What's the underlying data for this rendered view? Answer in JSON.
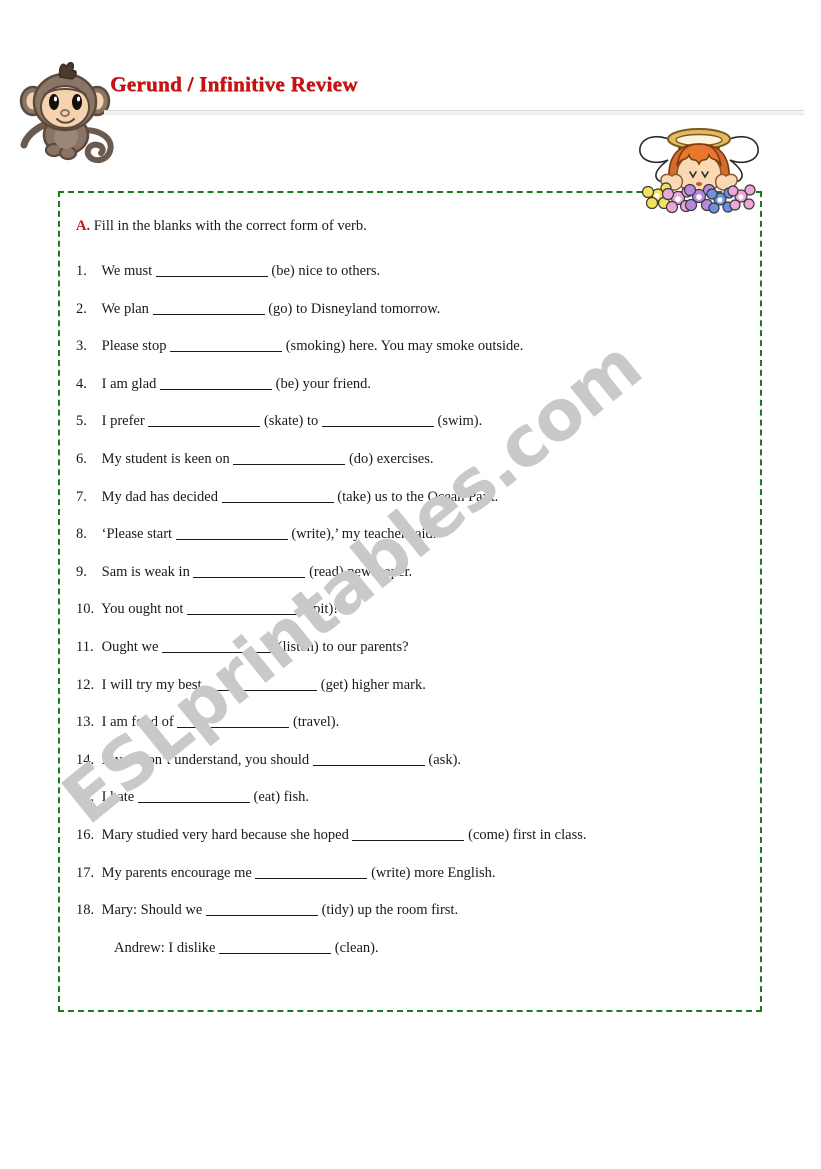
{
  "header": {
    "title": "Gerund / Infinitive Review",
    "title_color": "#cc1111",
    "monkey_icon": "monkey-clipart",
    "angel_icon": "angel-with-flowers-clipart"
  },
  "watermark": {
    "text": "ESLprintables.com",
    "color": "#c9c9c9"
  },
  "worksheet": {
    "border_color": "#1e7a1e",
    "instruction_marker": "A.",
    "instruction_text": "Fill in the blanks with the correct form of verb.",
    "items": [
      {
        "num": "1.",
        "pre": "We must",
        "cue": "(be) nice to others.",
        "blank_width": 112
      },
      {
        "num": "2.",
        "pre": "We plan",
        "cue": "(go) to Disneyland tomorrow.",
        "blank_width": 112
      },
      {
        "num": "3.",
        "pre": "Please stop",
        "cue": "(smoking) here.  You may smoke outside.",
        "blank_width": 112
      },
      {
        "num": "4.",
        "pre": "I am glad",
        "cue": "(be) your friend.",
        "blank_width": 112
      },
      {
        "num": "5.",
        "pre": "I prefer",
        "cue": "(skate) to",
        "blank_width": 112,
        "cue2": "(swim).",
        "blank2_width": 112
      },
      {
        "num": "6.",
        "pre": "My student is keen on",
        "cue": "(do) exercises.",
        "blank_width": 112
      },
      {
        "num": "7.",
        "pre": "My dad has decided",
        "cue": "(take) us to the Ocean Park.",
        "blank_width": 112
      },
      {
        "num": "8.",
        "pre": "‘Please start",
        "cue": "(write),’ my teacher said.",
        "blank_width": 112
      },
      {
        "num": "9.",
        "pre": "Sam is weak in",
        "cue": "(read) newspaper.",
        "blank_width": 112
      },
      {
        "num": "10.",
        "pre": "You ought not",
        "cue": "(spit)!",
        "blank_width": 112
      },
      {
        "num": "11.",
        "pre": "Ought we",
        "cue": "(listen) to our parents?",
        "blank_width": 112
      },
      {
        "num": "12.",
        "pre": "I will try my best",
        "cue": "(get) higher mark.",
        "blank_width": 112
      },
      {
        "num": "13.",
        "pre": "I am fond of",
        "cue": "(travel).",
        "blank_width": 112
      },
      {
        "num": "14.",
        "pre": "If you don’t understand, you should",
        "cue": "(ask).",
        "blank_width": 112
      },
      {
        "num": "15.",
        "pre": "I hate",
        "cue": "(eat) fish.",
        "blank_width": 112
      },
      {
        "num": "16.",
        "pre": "Mary studied very hard because she hoped",
        "cue": "(come) first in class.",
        "blank_width": 112
      },
      {
        "num": "17.",
        "pre": "My parents encourage me",
        "cue": "(write) more English.",
        "blank_width": 112
      },
      {
        "num": "18.",
        "pre": "Mary: Should we",
        "cue": "(tidy) up the room first.",
        "blank_width": 112
      },
      {
        "num": "",
        "pre": "Andrew: I dislike",
        "cue": "(clean).",
        "blank_width": 112,
        "indent": 38
      }
    ]
  }
}
